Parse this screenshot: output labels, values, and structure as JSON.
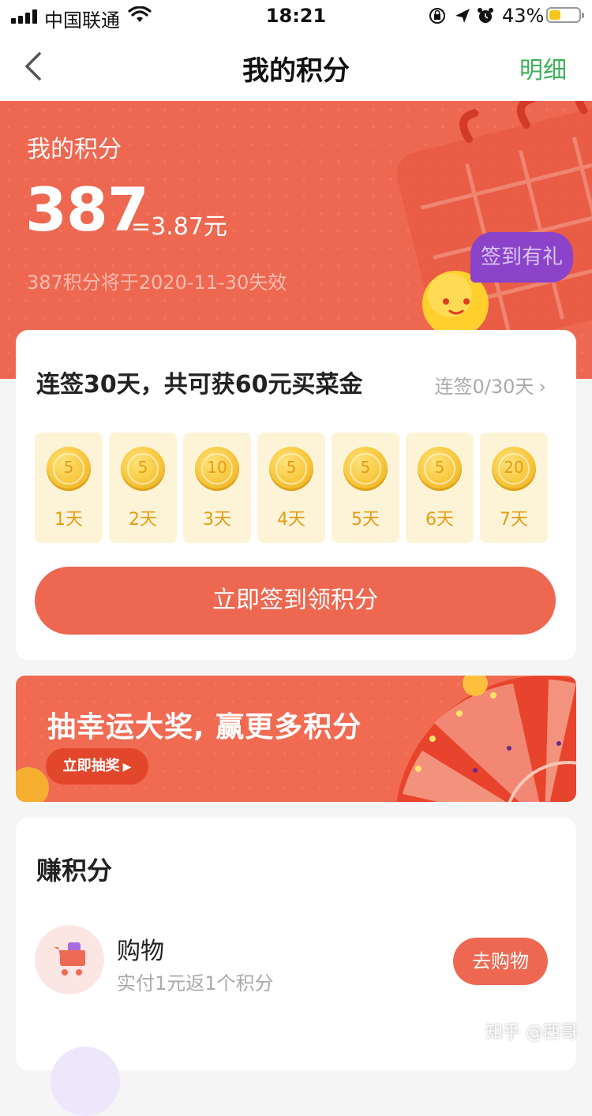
{
  "status_bar": {
    "carrier": "中国联通",
    "time": "18:21",
    "battery_percent": "43%"
  },
  "nav": {
    "title": "我的积分",
    "detail_label": "明细",
    "detail_color": "#3cb05a"
  },
  "hero": {
    "label": "我的积分",
    "points": "387",
    "value": "=3.87元",
    "expire_note": "387积分将于2020-11-30失效",
    "gift_button": "签到有礼",
    "background_color": "#ee6851"
  },
  "signin": {
    "title": "连签30天，共可获60元买菜金",
    "progress": "连签0/30天",
    "days": [
      {
        "coin": "5",
        "label": "1天"
      },
      {
        "coin": "5",
        "label": "2天"
      },
      {
        "coin": "10",
        "label": "3天"
      },
      {
        "coin": "5",
        "label": "4天"
      },
      {
        "coin": "5",
        "label": "5天"
      },
      {
        "coin": "5",
        "label": "6天"
      },
      {
        "coin": "20",
        "label": "7天"
      }
    ],
    "button_label": "立即签到领积分"
  },
  "lottery": {
    "title": "抽幸运大奖, 赢更多积分",
    "button_label": "立即抽奖"
  },
  "earn": {
    "title": "赚积分",
    "tasks": [
      {
        "name": "购物",
        "desc": "实付1元返1个积分",
        "button": "去购物",
        "icon": "shopping-cart-icon"
      }
    ]
  },
  "watermark": "知乎 @西哥"
}
